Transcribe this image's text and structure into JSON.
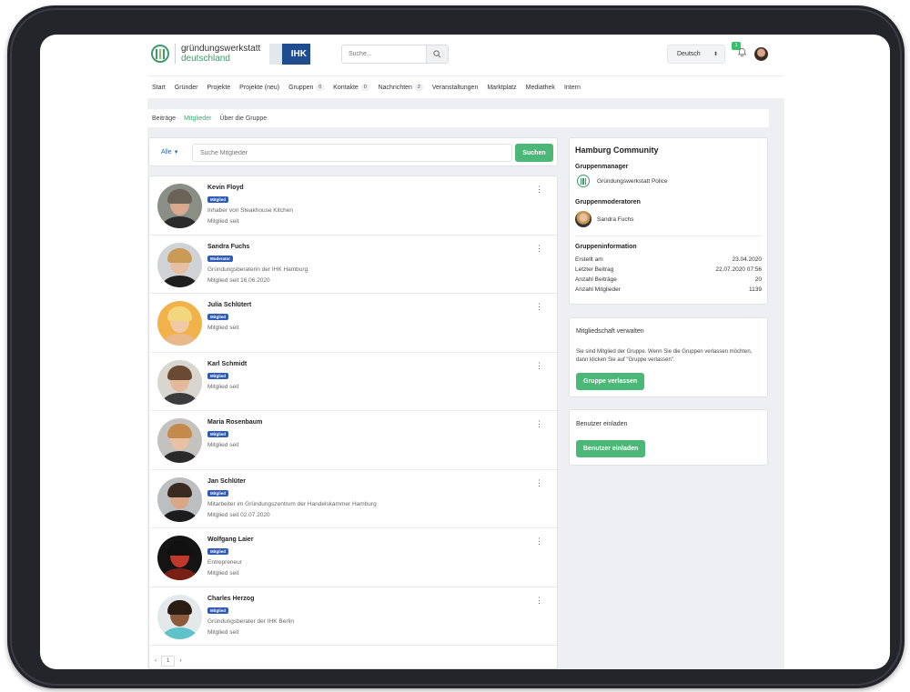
{
  "brand": {
    "line1": "gründungswerkstatt",
    "line2": "deutschland",
    "partner": "IHK"
  },
  "header": {
    "search_placeholder": "Suche...",
    "language": "Deutsch",
    "notification_count": "1"
  },
  "nav": [
    {
      "label": "Start",
      "badge": null
    },
    {
      "label": "Gründer",
      "badge": null
    },
    {
      "label": "Projekte",
      "badge": null
    },
    {
      "label": "Projekte (neu)",
      "badge": null
    },
    {
      "label": "Gruppen",
      "badge": "0"
    },
    {
      "label": "Kontakte",
      "badge": "0"
    },
    {
      "label": "Nachrichten",
      "badge": "2"
    },
    {
      "label": "Veranstaltungen",
      "badge": null
    },
    {
      "label": "Marktplatz",
      "badge": null
    },
    {
      "label": "Mediathek",
      "badge": null
    },
    {
      "label": "Intern",
      "badge": null
    }
  ],
  "subtabs": [
    {
      "label": "Beiträge",
      "active": false
    },
    {
      "label": "Mitglieder",
      "active": true
    },
    {
      "label": "Über die Gruppe",
      "active": false
    }
  ],
  "filter": {
    "select": "Alle",
    "placeholder": "Suche Mitglieder",
    "button": "Suchen"
  },
  "members": [
    {
      "name": "Kevin Floyd",
      "role": "Mitglied",
      "line1": "Inhaber von Steakhouse Kitchen",
      "line2": "Mitglied seit",
      "avatar": {
        "skin": "#d8a98c",
        "hair": "#6b6258",
        "body": "#2b2b2b",
        "bg": "#8a8f86"
      }
    },
    {
      "name": "Sandra Fuchs",
      "role": "Moderator",
      "line1": "Gründungsberaterin der IHK Hamburg",
      "line2": "Mitglied seit 16.06.2020",
      "avatar": {
        "skin": "#e6bfa3",
        "hair": "#c99a55",
        "body": "#1f1f1f",
        "bg": "#cfd3d6"
      }
    },
    {
      "name": "Julia Schlütert",
      "role": "Mitglied",
      "line1": "",
      "line2": "Mitglied seit",
      "avatar": {
        "skin": "#f0c9a6",
        "hair": "#f2d77e",
        "body": "#e7b98b",
        "bg": "#f2b24a"
      }
    },
    {
      "name": "Karl Schmidt",
      "role": "Mitglied",
      "line1": "",
      "line2": "Mitglied seit",
      "avatar": {
        "skin": "#e3b89b",
        "hair": "#6b4a32",
        "body": "#3c3c3c",
        "bg": "#d9d6d0"
      }
    },
    {
      "name": "Maria Rosenbaum",
      "role": "Mitglied",
      "line1": "",
      "line2": "Mitglied seit",
      "avatar": {
        "skin": "#e8c1a2",
        "hair": "#c38a4c",
        "body": "#2a2a2a",
        "bg": "#c4c2bf"
      }
    },
    {
      "name": "Jan Schlüter",
      "role": "Mitglied",
      "line1": "Mitarbeiter im Gründungszentrum der Handelskammer Hamburg",
      "line2": "Mitglied seit 02.07.2020",
      "avatar": {
        "skin": "#d9a786",
        "hair": "#3b2a1f",
        "body": "#1c1c1c",
        "bg": "#bcbfc2"
      }
    },
    {
      "name": "Wolfgang Laier",
      "role": "Mitglied",
      "line1": "Entrepreneur",
      "line2": "Mitglied seit",
      "avatar": {
        "skin": "#c0392b",
        "hair": "#111111",
        "body": "#7a1f16",
        "bg": "#141414"
      }
    },
    {
      "name": "Charles Herzog",
      "role": "Mitglied",
      "line1": "Gründungsberater der IHK Berlin",
      "line2": "Mitglied seit",
      "avatar": {
        "skin": "#8d5a3b",
        "hair": "#2a1d14",
        "body": "#5ec2c8",
        "bg": "#e3e8ea"
      }
    }
  ],
  "pager": {
    "prev": "‹",
    "current": "1",
    "next": "›"
  },
  "community": {
    "title": "Hamburg Community",
    "manager_heading": "Gruppenmanager",
    "manager_name": "Gründungswerkstatt Police",
    "moderator_heading": "Gruppenmoderatoren",
    "moderator_name": "Sandra Fuchs",
    "info_heading": "Gruppeninformation",
    "info": [
      {
        "label": "Erstellt am",
        "value": "23.04.2020"
      },
      {
        "label": "Letzter Beitrag",
        "value": "22.07.2020 07:56"
      },
      {
        "label": "Anzahl Beiträge",
        "value": "20"
      },
      {
        "label": "Anzahl Mitglieder",
        "value": "1139"
      }
    ]
  },
  "membership": {
    "title": "Mitgliedschaft verwalten",
    "text": "Sie sind Mitglied der Gruppe. Wenn Sie die Gruppen verlassen möchten, dann klicken Sie auf \"Gruppe verlassen\".",
    "button": "Gruppe verlassen"
  },
  "invite": {
    "title": "Benutzer einladen",
    "button": "Benutzer einladen"
  },
  "colors": {
    "accent_green": "#4bb877",
    "badge_blue": "#2f5bb3",
    "link_blue": "#2668b8"
  }
}
